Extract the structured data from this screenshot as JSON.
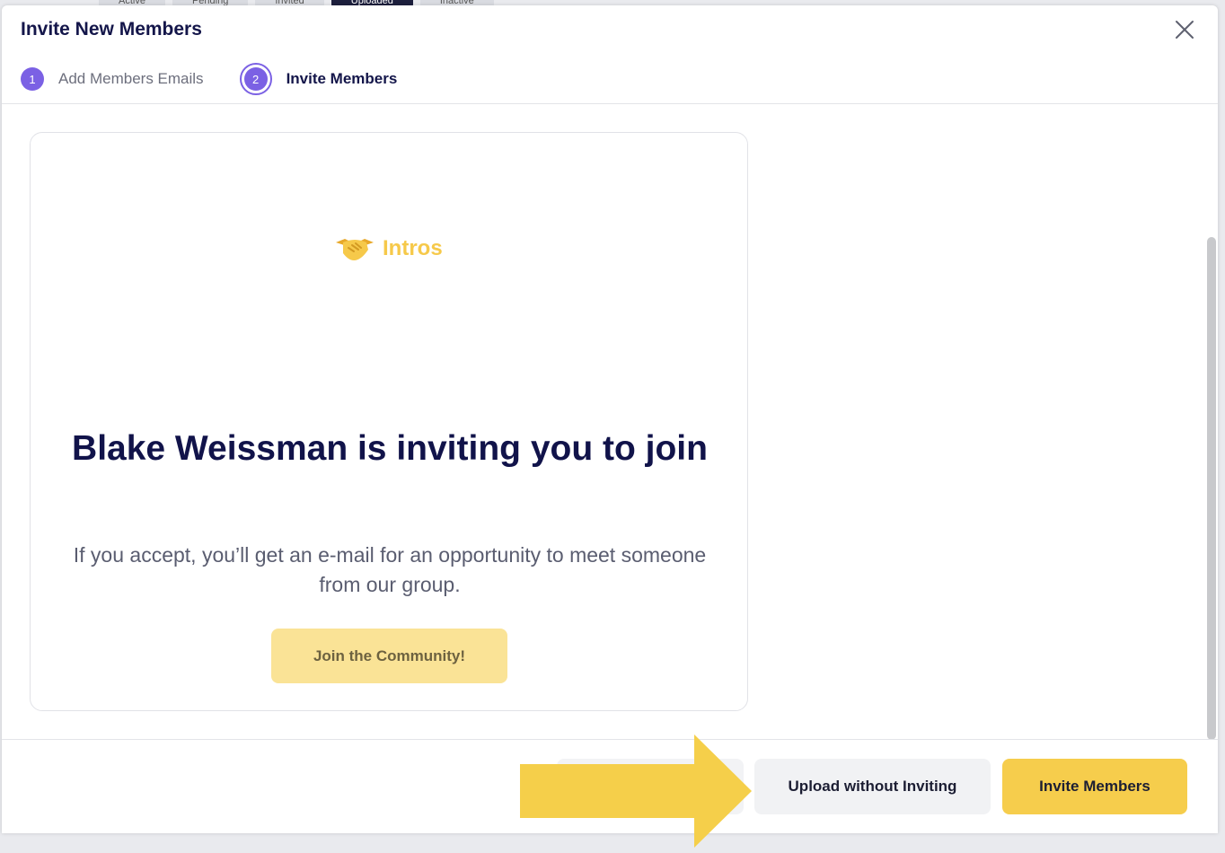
{
  "background": {
    "tabs": [
      "Active",
      "Pending",
      "Invited",
      "Uploaded",
      "Inactive"
    ],
    "active_tab_index": 3
  },
  "modal": {
    "title": "Invite New Members",
    "steps": [
      {
        "number": "1",
        "label": "Add Members Emails",
        "state": "completed"
      },
      {
        "number": "2",
        "label": "Invite Members",
        "state": "current"
      }
    ]
  },
  "preview": {
    "logo_text": "Intros",
    "logo_icon": "handshake-icon",
    "heading": "Blake Weissman is inviting you to join",
    "subtext": "If you accept, you’ll get an e-mail for an opportunity to meet someone from our group.",
    "join_label": "Join the Community!"
  },
  "footer": {
    "upload_label": "Upload without Inviting",
    "invite_label": "Invite Members"
  },
  "colors": {
    "accent_purple": "#7b61e4",
    "brand_yellow": "#f6cd4c",
    "heading_navy": "#11134a",
    "arrow_yellow": "#f5cf4a"
  }
}
